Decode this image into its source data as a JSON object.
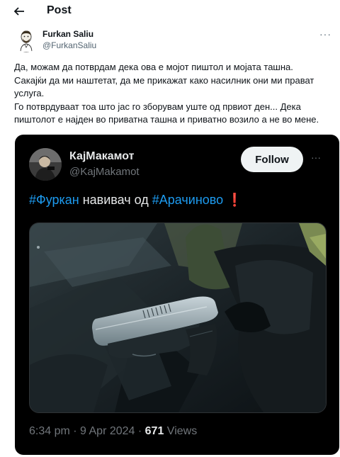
{
  "header": {
    "title": "Post",
    "back_icon": "arrow-left-icon"
  },
  "author": {
    "name": "Furkan Saliu",
    "handle": "@FurkanSaliu",
    "more_icon": "···"
  },
  "post": {
    "paragraphs": [
      "Да, можам да потврдам дека ова е мојот пиштол и мојата ташна.",
      "Сакајќи да ми наштетат, да ме прикажат како насилник они ми прават\nуслуга.",
      "Го потврдуваат тоа што јас го зборувам уште од првиот ден... Дека\nпиштолот е најден во приватна ташна и приватно возило а не во мене."
    ]
  },
  "embedded": {
    "name": "КајМакамот",
    "handle": "@KajMakamot",
    "follow_label": "Follow",
    "more_icon": "···",
    "text_hashtag1": "#Фуркан",
    "text_middle": " навивач од ",
    "text_hashtag2": "#Арачиново",
    "text_emoji": " ❗",
    "time": "6:34 pm",
    "sep1": " · ",
    "date": "9 Apr 2024",
    "sep2": " · ",
    "views_count": "671",
    "views_label": " Views"
  },
  "colors": {
    "accent": "#1d9bf0",
    "embed_bg": "#000000",
    "muted": "#536471"
  }
}
